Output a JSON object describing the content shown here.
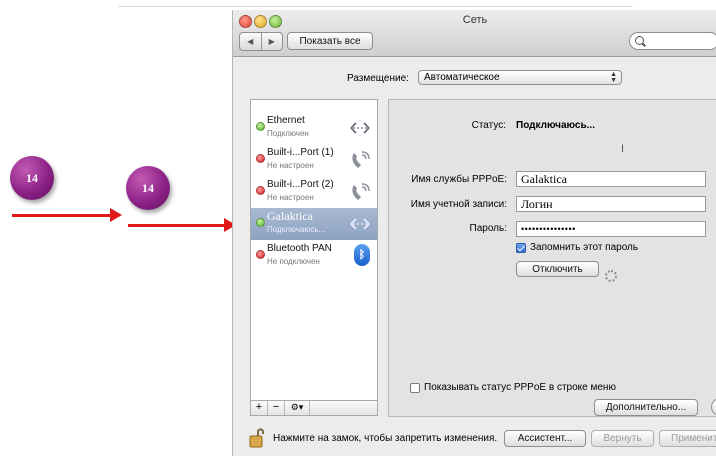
{
  "annotations": {
    "badge1": "14",
    "badge2": "14"
  },
  "window": {
    "title": "Сеть",
    "nav_back": "◀",
    "nav_forward": "▶",
    "show_all_label": "Показать все",
    "search_icon": "search-icon"
  },
  "location": {
    "label": "Размещение:",
    "value": "Автоматическое"
  },
  "services": [
    {
      "name": "Ethernet",
      "status": "Подключен",
      "state": "green",
      "icon": "ethernet-icon"
    },
    {
      "name": "Built-i...Port (1)",
      "status": "Не настроен",
      "state": "red",
      "icon": "phone-modem-icon"
    },
    {
      "name": "Built-i...Port (2)",
      "status": "Не настроен",
      "state": "red",
      "icon": "phone-modem-icon"
    },
    {
      "name": "Galaktica",
      "status": "Подключаюсь...",
      "state": "green",
      "icon": "ethernet-icon",
      "selected": true
    },
    {
      "name": "Bluetooth PAN",
      "status": "Не подключен",
      "state": "red",
      "icon": "bluetooth-icon"
    }
  ],
  "list_buttons": {
    "add": "+",
    "remove": "−",
    "gear": "⚙▾"
  },
  "detail": {
    "status_label": "Статус:",
    "status_value": "Подключаюсь...",
    "service_name_label": "Имя службы PPPoE:",
    "service_name_value": "Galaktica",
    "account_label": "Имя учетной записи:",
    "account_value": "Логин",
    "password_label": "Пароль:",
    "password_value": "•••••••••••••••",
    "remember_label": "Запомнить этот пароль",
    "remember_checked": true,
    "disconnect_label": "Отключить",
    "show_status_label": "Показывать статус PPPoE в строке меню",
    "show_status_checked": false,
    "advanced_label": "Дополнительно...",
    "help_label": "?"
  },
  "footer": {
    "lock_text": "Нажмите на замок, чтобы запретить изменения.",
    "assistant_label": "Ассистент...",
    "revert_label": "Вернуть",
    "apply_label": "Применить"
  }
}
